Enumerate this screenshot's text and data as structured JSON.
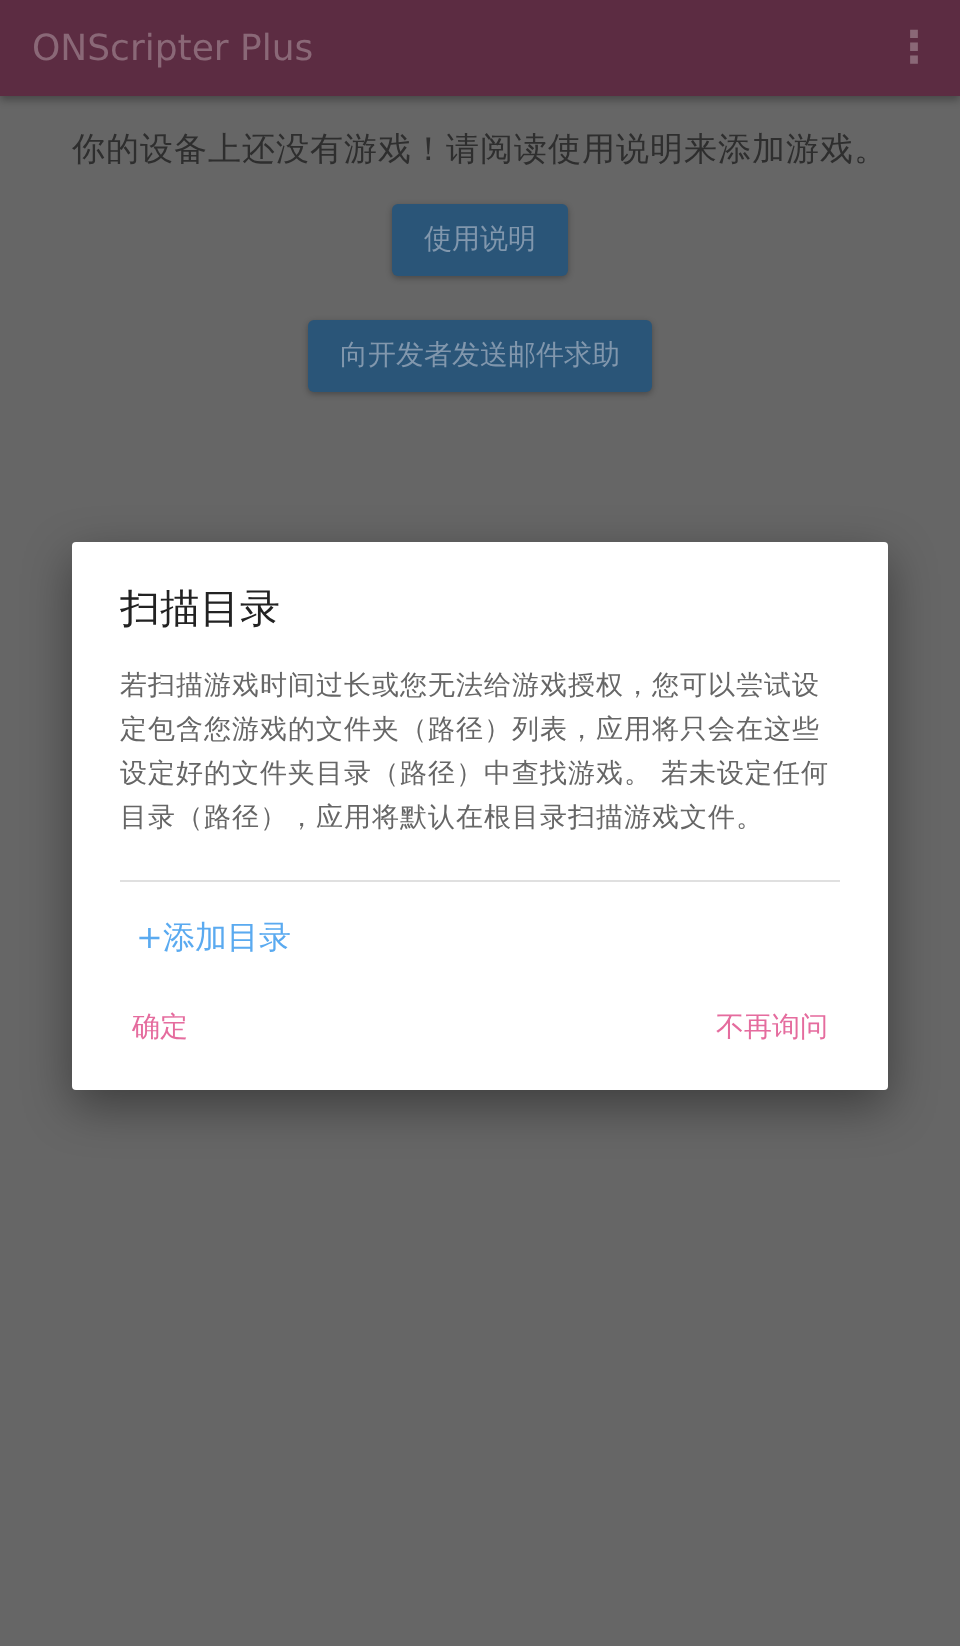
{
  "app_bar": {
    "title": "ONScripter Plus",
    "menu_icon": "⋮"
  },
  "page": {
    "message": "你的设备上还没有游戏！请阅读使用说明来添加游戏。",
    "buttons": [
      "使用说明",
      "向开发者发送邮件求助"
    ]
  },
  "dialog": {
    "title": "扫描目录",
    "body": "若扫描游戏时间过长或您无法给游戏授权，您可以尝试设定包含您游戏的文件夹（路径）列表，应用将只会在这些设定好的文件夹目录（路径）中查找游戏。 若未设定任何目录（路径），应用将默认在根目录扫描游戏文件。",
    "add_link": "+添加目录",
    "actions": [
      "确定",
      "不再询问"
    ]
  }
}
